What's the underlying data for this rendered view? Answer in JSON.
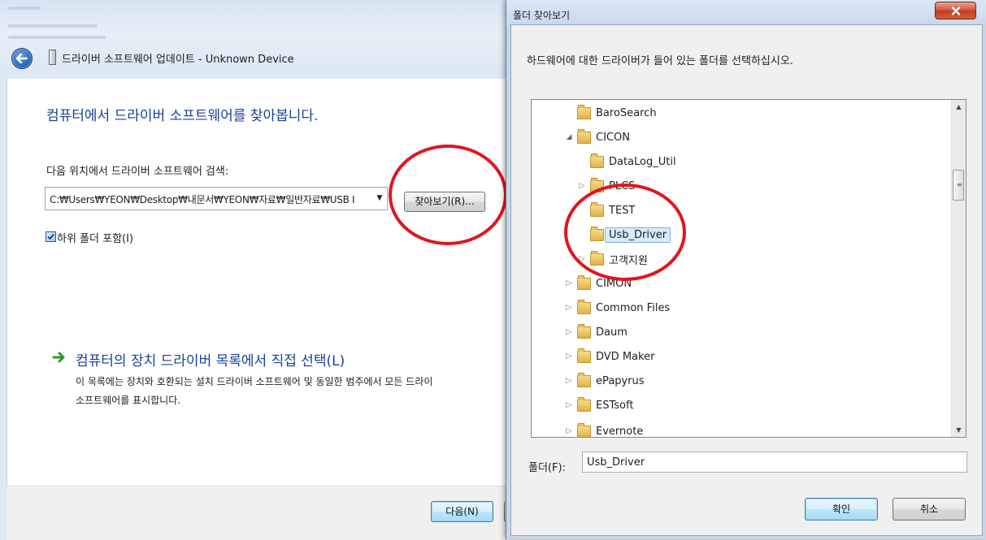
{
  "wizard": {
    "title": "드라이버 소프트웨어 업데이트 - Unknown Device",
    "heading": "컴퓨터에서 드라이버 소프트웨어를 찾아봅니다.",
    "search_label": "다음 위치에서 드라이버 소프트웨어 검색:",
    "path_value": "C:₩Users₩YEON₩Desktop₩내문서₩YEON₩자료₩일반자료₩USB I",
    "browse_button": "찾아보기(R)...",
    "include_subfolders_label": "하위 폴더 포함(I)",
    "include_subfolders_checked": true,
    "manual_select_title": "컴퓨터의 장치 드라이버 목록에서 직접 선택(L)",
    "manual_select_desc_line1": "이 목록에는 장치와 호환되는 설치 드라이버 소프트웨어 및 동일한 범주에서 모든 드라이",
    "manual_select_desc_line2": "소프트웨어를 표시합니다.",
    "next_button": "다음(N)"
  },
  "dialog": {
    "title": "폴더 찾아보기",
    "instruction": "하드웨어에 대한 드라이버가 들어 있는 폴더를 선택하십시오.",
    "tree": [
      {
        "label": "BaroSearch",
        "expander": "none"
      },
      {
        "label": "CICON",
        "expander": "expanded"
      },
      {
        "label": "DataLog_Util",
        "expander": "none"
      },
      {
        "label": "PLCS",
        "expander": "collapsed"
      },
      {
        "label": "TEST",
        "expander": "none"
      },
      {
        "label": "Usb_Driver",
        "expander": "none",
        "selected": true
      },
      {
        "label": "고객지원",
        "expander": "collapsed"
      },
      {
        "label": "CIMON",
        "expander": "collapsed"
      },
      {
        "label": "Common Files",
        "expander": "collapsed"
      },
      {
        "label": "Daum",
        "expander": "collapsed"
      },
      {
        "label": "DVD Maker",
        "expander": "collapsed"
      },
      {
        "label": "ePapyrus",
        "expander": "collapsed"
      },
      {
        "label": "ESTsoft",
        "expander": "collapsed"
      },
      {
        "label": "Evernote",
        "expander": "collapsed"
      }
    ],
    "folder_label": "폴더(F):",
    "folder_value": "Usb_Driver",
    "ok_button": "확인",
    "cancel_button": "취소",
    "close_glyph": "x"
  },
  "colors": {
    "heading_blue": "#1b3f9a",
    "highlight_red": "#e0161f",
    "selection_bg": "#d9ebfb"
  }
}
